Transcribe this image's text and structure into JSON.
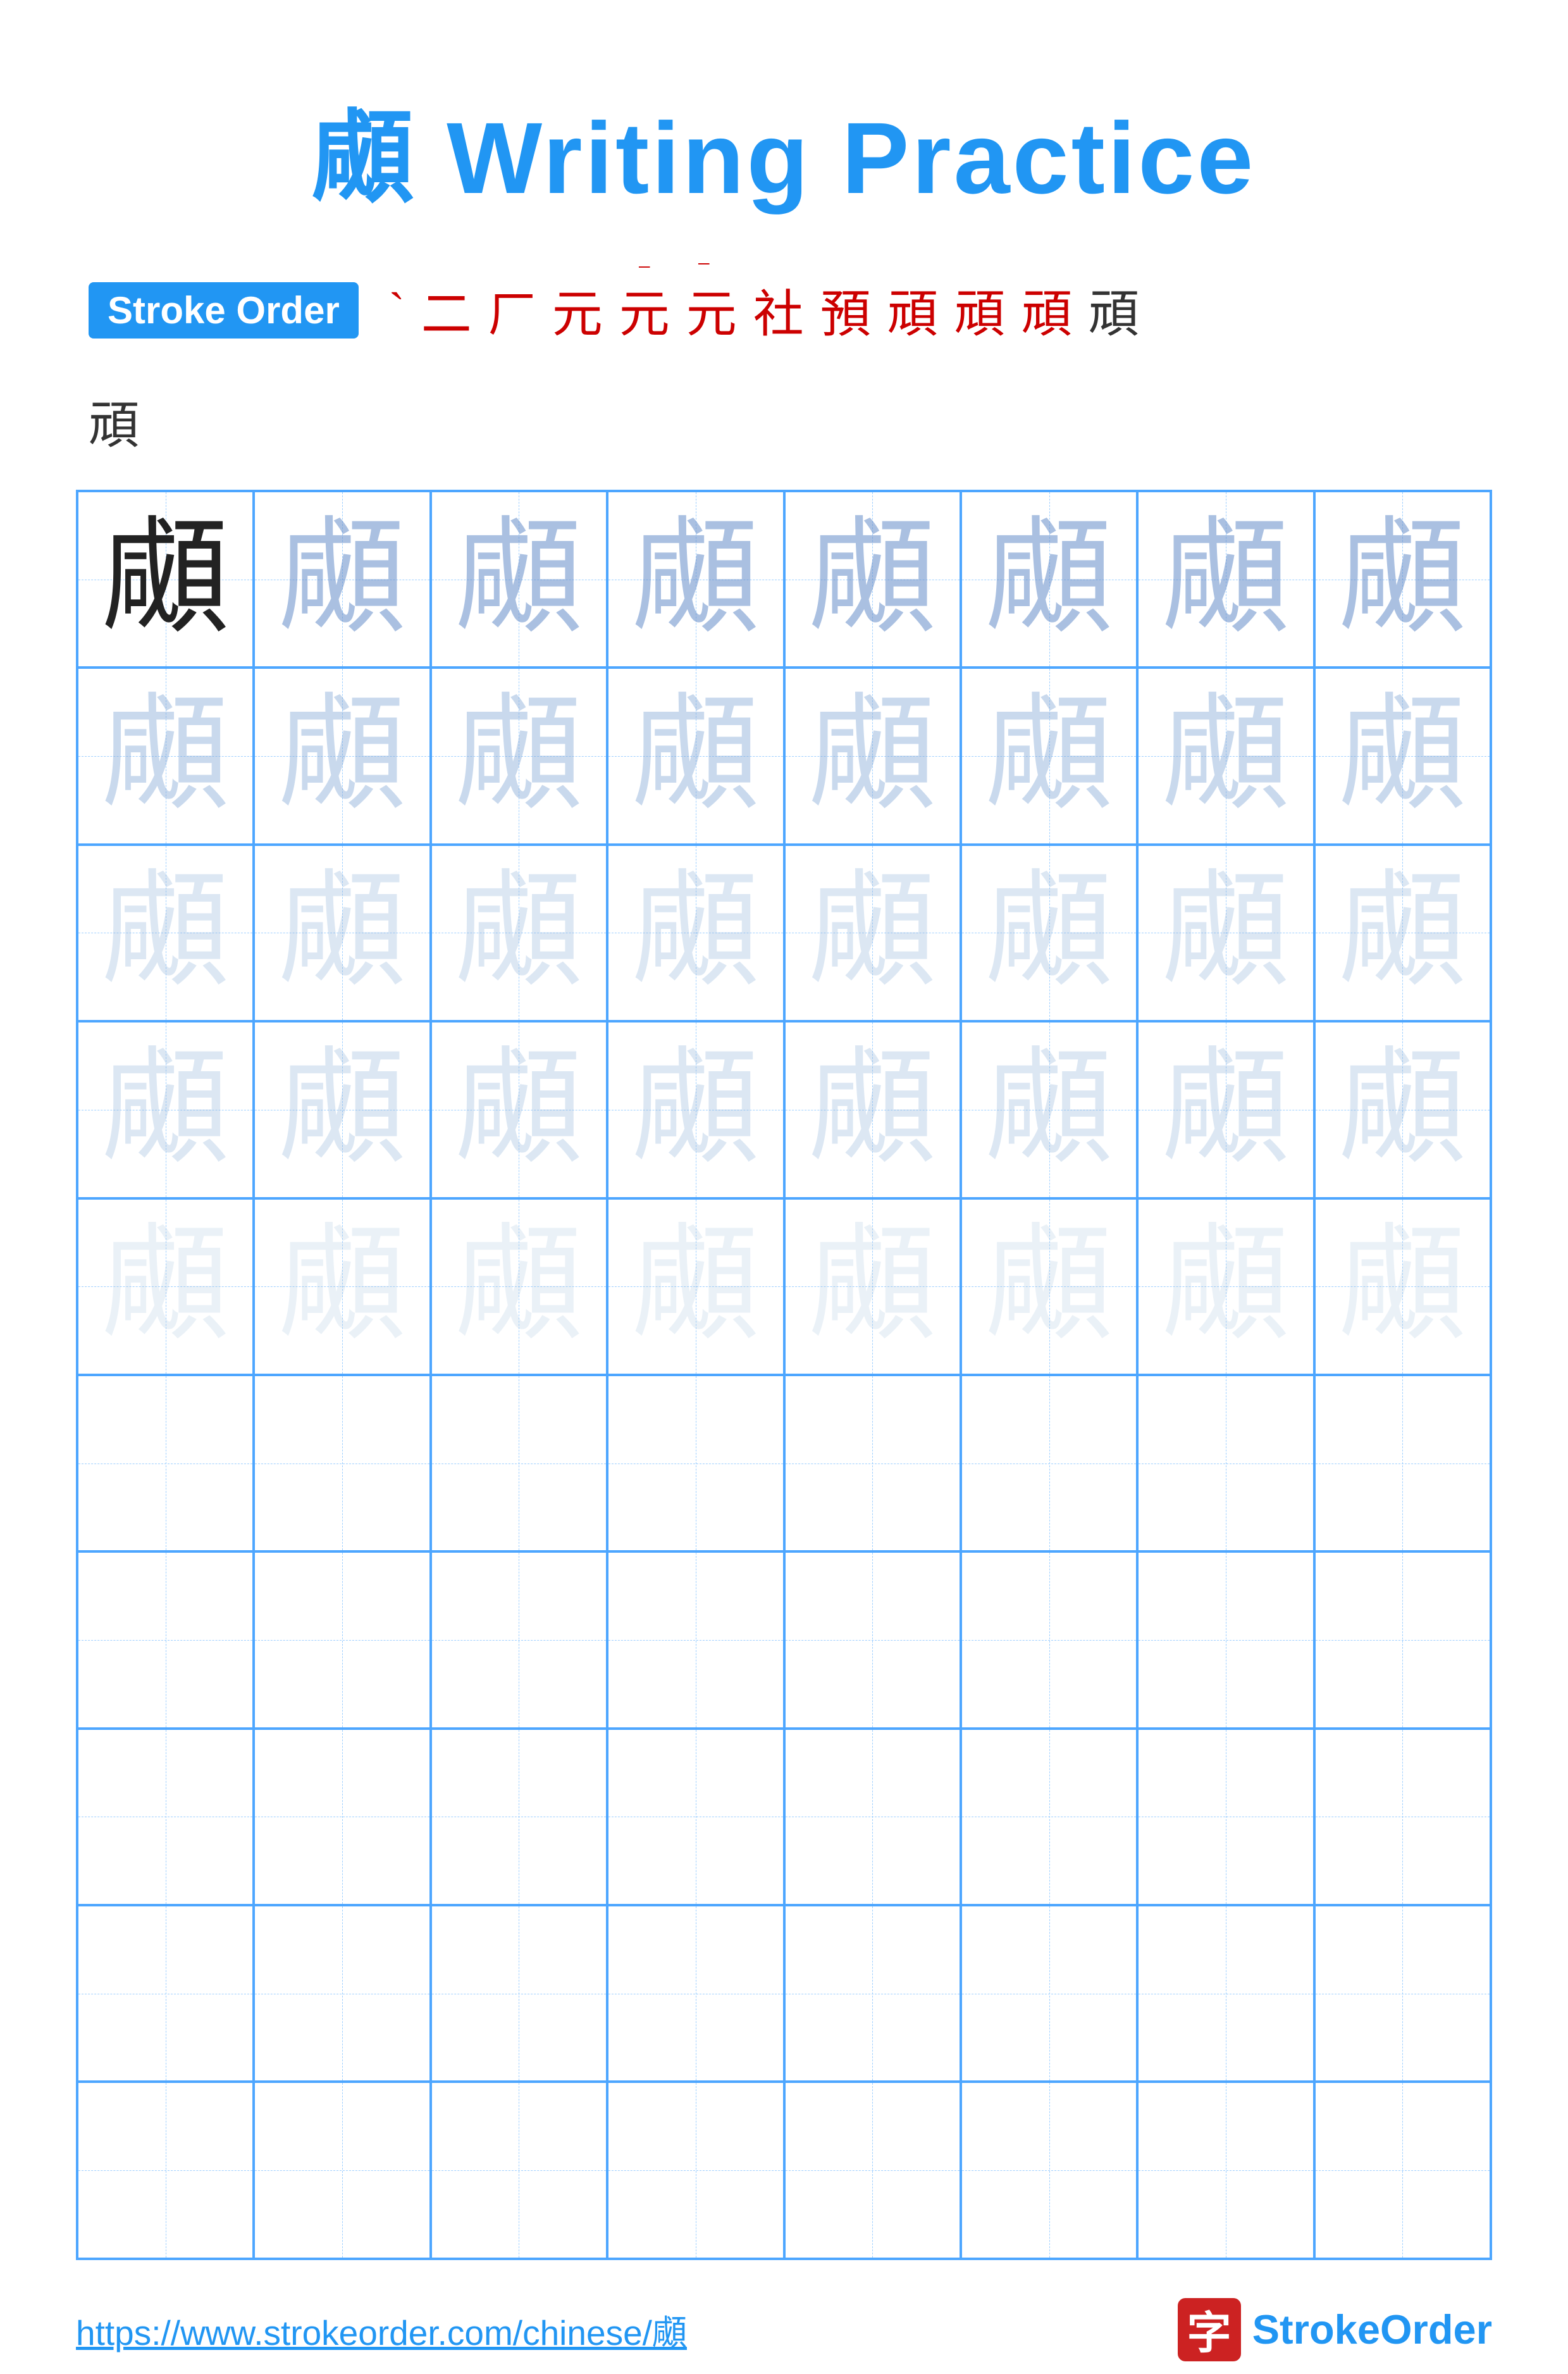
{
  "title": "顑 Writing Practice",
  "stroke_order": {
    "badge_label": "Stroke Order",
    "strokes": [
      "丶",
      "㇀",
      "㇒",
      "𠃋",
      "𠃊",
      "𠄌",
      "𠄎",
      "頁",
      "頁頁",
      "顑",
      "顑顑",
      "顑顑顑",
      "顑"
    ],
    "stroke_chars_display": [
      "`",
      "⼆",
      "㇒",
      "元",
      "元⁻",
      "元⁺",
      "㪠",
      "頁⁰",
      "頁¹",
      "顑⁰",
      "顑¹",
      "顑²"
    ],
    "final_char": "顑"
  },
  "practice_char": "顑",
  "rows": [
    {
      "type": "practice",
      "opacity_class": "row1"
    },
    {
      "type": "practice",
      "opacity_class": "row2"
    },
    {
      "type": "practice",
      "opacity_class": "row3"
    },
    {
      "type": "practice",
      "opacity_class": "row4"
    },
    {
      "type": "practice",
      "opacity_class": "row5"
    },
    {
      "type": "empty"
    },
    {
      "type": "empty"
    },
    {
      "type": "empty"
    },
    {
      "type": "empty"
    },
    {
      "type": "empty"
    }
  ],
  "footer": {
    "url": "https://www.strokeorder.com/chinese/顑",
    "logo_char": "字",
    "logo_text_stroke": "Stroke",
    "logo_text_order": "Order"
  }
}
